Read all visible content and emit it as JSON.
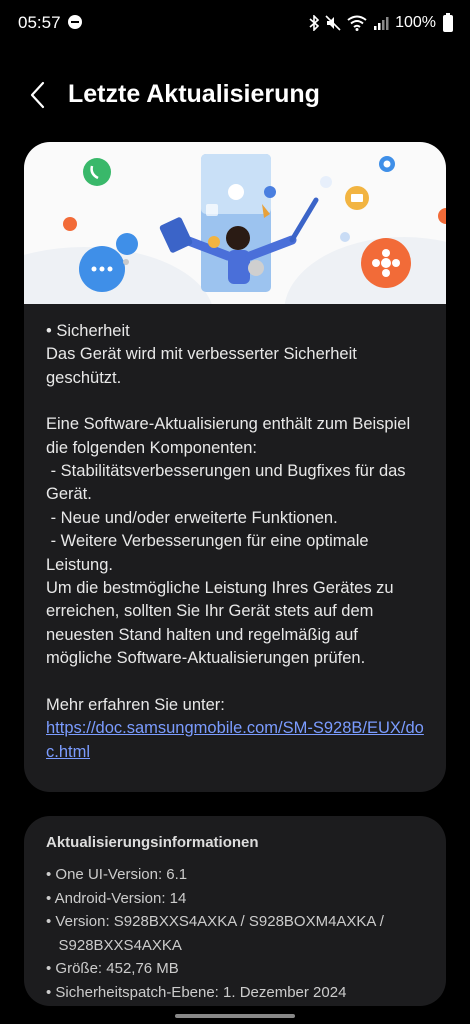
{
  "status_bar": {
    "time": "05:57",
    "battery": "100%"
  },
  "header": {
    "title": "Letzte Aktualisierung"
  },
  "update_notes": {
    "p1": "• Sicherheit\nDas Gerät wird mit verbesserter Sicherheit geschützt.",
    "p2": "Eine Software-Aktualisierung enthält zum Beispiel die folgenden Komponenten:\n - Stabilitätsverbesserungen und Bugfixes für das Gerät.\n - Neue und/oder erweiterte Funktionen.\n - Weitere Verbesserungen für eine optimale Leistung.\nUm die bestmögliche Leistung Ihres Gerätes zu erreichen, sollten Sie Ihr Gerät stets auf dem neuesten Stand halten und regelmäßig auf mögliche Software-Aktualisierungen prüfen.",
    "more_info_label": "Mehr erfahren Sie unter:",
    "link": "https://doc.samsungmobile.com/SM-S928B/EUX/doc.html"
  },
  "update_info": {
    "title": "Aktualisierungsinformationen",
    "items": [
      "• One UI-Version: 6.1",
      "• Android-Version: 14",
      "• Version: S928BXXS4AXKA / S928BOXM4AXKA /\n   S928BXXS4AXKA",
      "• Größe: 452,76 MB",
      "• Sicherheitspatch-Ebene: 1. Dezember 2024"
    ]
  }
}
